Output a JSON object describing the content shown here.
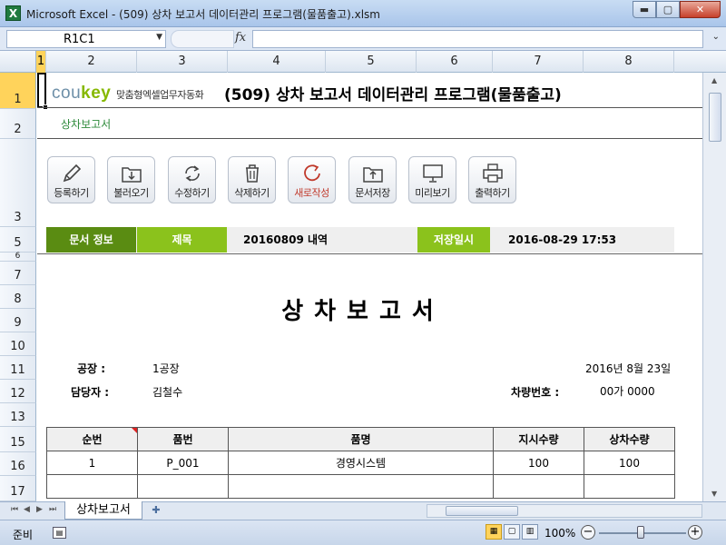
{
  "window": {
    "app_icon": "X",
    "title": "Microsoft Excel - (509) 상차 보고서 데이터관리 프로그램(물품출고).xlsm",
    "min_label": "▬",
    "max_label": "▢",
    "close_label": "✕"
  },
  "formula_bar": {
    "name_box": "R1C1",
    "fx_label": "fx",
    "formula": ""
  },
  "columns": [
    "1",
    "2",
    "3",
    "4",
    "5",
    "6",
    "7",
    "8"
  ],
  "rows": [
    "1",
    "2",
    "3",
    "5",
    "6",
    "7",
    "8",
    "9",
    "10",
    "11",
    "12",
    "13",
    "15",
    "16",
    "17"
  ],
  "logo": {
    "word_a": "cou",
    "word_b": "key",
    "tagline": "맞춤형엑셀업무자동화"
  },
  "page_heading": "(509) 상차 보고서 데이터관리 프로그램(물품출고)",
  "subtitle": "상차보고서",
  "toolbar": {
    "items": [
      {
        "label": "등록하기",
        "icon": "pencil-icon"
      },
      {
        "label": "불러오기",
        "icon": "folder-download-icon"
      },
      {
        "label": "수정하기",
        "icon": "refresh-icon"
      },
      {
        "label": "삭제하기",
        "icon": "trash-icon"
      },
      {
        "label": "새로작성",
        "icon": "new-doc-icon"
      },
      {
        "label": "문서저장",
        "icon": "folder-upload-icon"
      },
      {
        "label": "미리보기",
        "icon": "monitor-icon"
      },
      {
        "label": "출력하기",
        "icon": "printer-icon"
      }
    ]
  },
  "info": {
    "doc_label": "문서 정보",
    "title_label": "제목",
    "title_value": "20160809 내역",
    "date_label": "저장일시",
    "date_value": "2016-08-29 17:53"
  },
  "report": {
    "title": "상차보고서",
    "factory_label": "공장 :",
    "factory_value": "1공장",
    "date": "2016년 8월 23일",
    "manager_label": "담당자 :",
    "manager_value": "김철수",
    "vehicle_label": "차량번호 :",
    "vehicle_value": "00가 0000"
  },
  "table": {
    "headers": [
      "순번",
      "품번",
      "품명",
      "지시수량",
      "상차수량"
    ],
    "rows": [
      [
        "1",
        "P_001",
        "경영시스템",
        "100",
        "100"
      ],
      [
        "",
        "",
        "",
        "",
        ""
      ]
    ]
  },
  "sheet_tabs": {
    "active": "상차보고서"
  },
  "status": {
    "ready": "준비",
    "zoom": "100%"
  },
  "colors": {
    "accent_green_dark": "#5a8c12",
    "accent_green": "#8bc21c",
    "subtitle_green": "#2d8a3a",
    "selection_yellow": "#ffd35b"
  }
}
